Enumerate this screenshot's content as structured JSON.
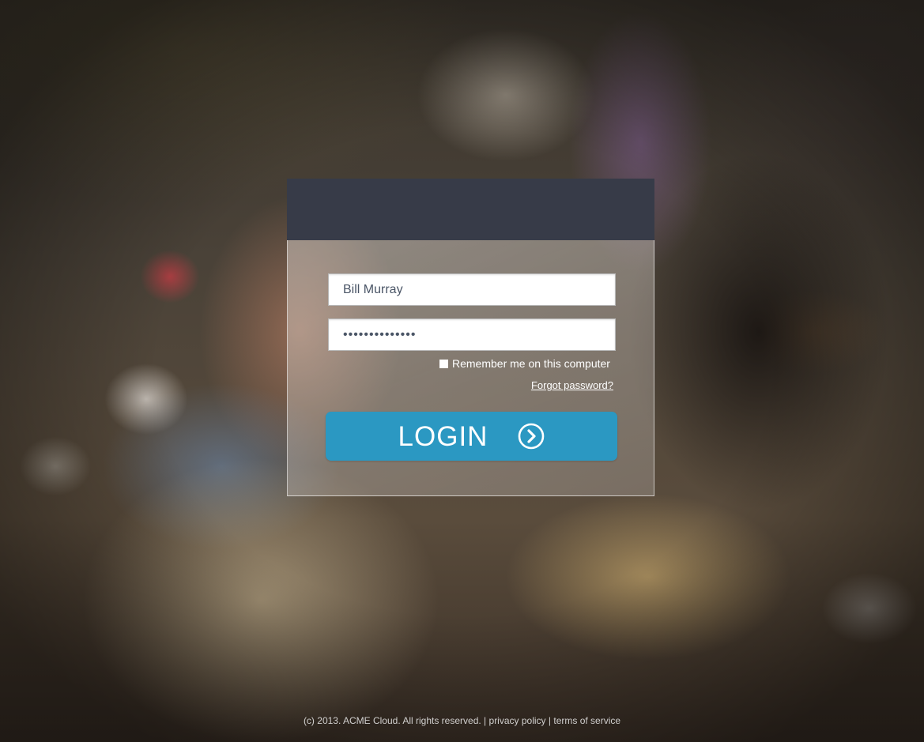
{
  "login_form": {
    "username_value": "Bill Murray",
    "password_value": "••••••••••••••",
    "remember_label": "Remember me on this computer",
    "remember_checked": false,
    "forgot_label": "Forgot password?",
    "login_label": "LOGIN",
    "login_icon": "chevron-right-circle-icon"
  },
  "footer": {
    "copyright": "(c) 2013. ACME Cloud. All rights reserved.",
    "separator": "|",
    "privacy": "privacy policy",
    "terms": "terms of service"
  },
  "colors": {
    "header": "#373b48",
    "button": "#2b98c2",
    "text_on_glass": "#ffffff"
  }
}
